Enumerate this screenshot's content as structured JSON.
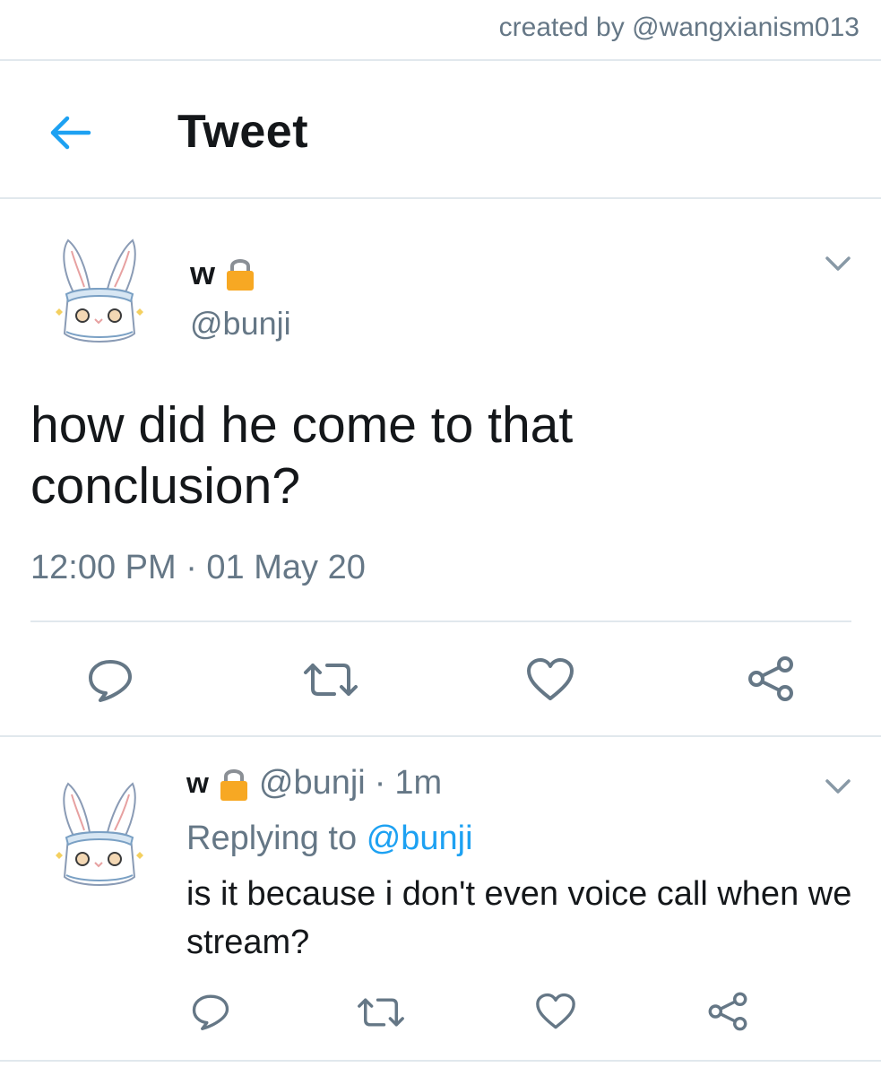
{
  "credit": "created by @wangxianism013",
  "header": {
    "title": "Tweet"
  },
  "main_tweet": {
    "name": "w",
    "handle": "@bunji",
    "text": "how did he come to that conclusion?",
    "timestamp": "12:00 PM · 01 May 20"
  },
  "reply": {
    "name": "w",
    "handle": "@bunji",
    "separator": "·",
    "age": "1m",
    "replying_prefix": "Replying to",
    "replying_to": "@bunji",
    "text": "is it because i don't even voice call when we stream?"
  },
  "icons": {
    "back": "arrow-left-icon",
    "lock": "lock-icon",
    "caret": "chevron-down-icon",
    "reply": "reply-icon",
    "retweet": "retweet-icon",
    "like": "heart-icon",
    "share": "share-icon"
  },
  "colors": {
    "accent": "#1da1f2",
    "muted_text": "#657786",
    "text": "#14171a",
    "divider": "#e1e8ed",
    "lock": "#f7a823"
  }
}
